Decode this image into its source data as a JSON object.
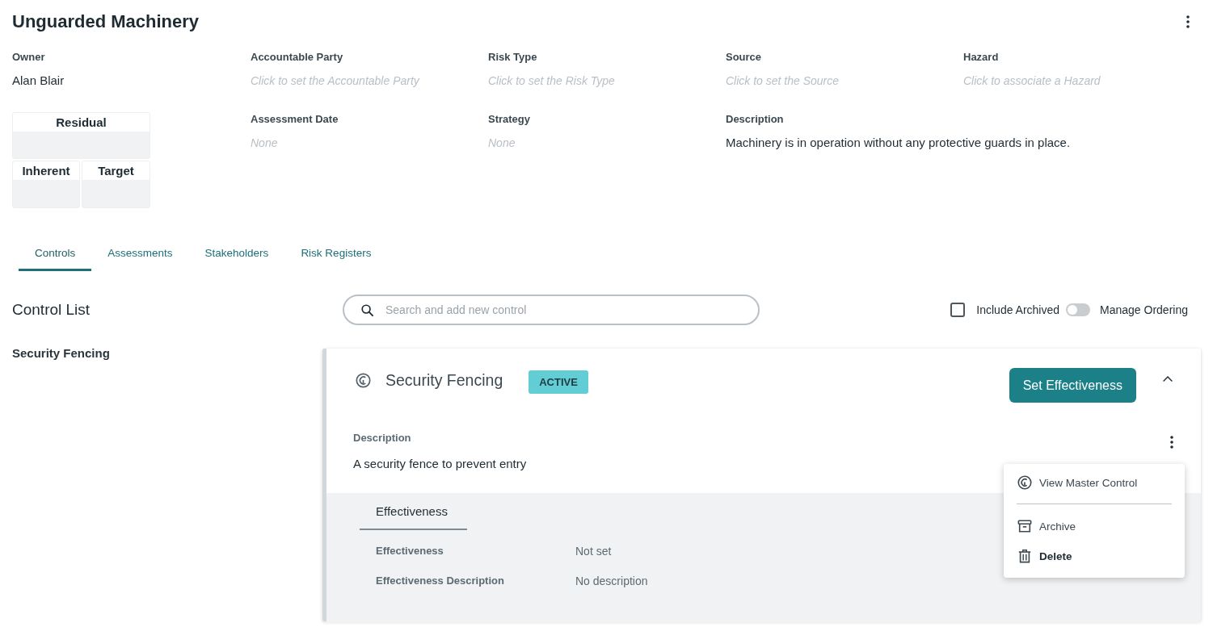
{
  "header": {
    "title": "Unguarded Machinery"
  },
  "fields": [
    {
      "label": "Owner",
      "value": "Alan Blair"
    },
    {
      "label": "Accountable Party",
      "placeholder": "Click to set the Accountable Party"
    },
    {
      "label": "Risk Type",
      "placeholder": "Click to set the Risk Type"
    },
    {
      "label": "Source",
      "placeholder": "Click to set the Source"
    },
    {
      "label": "Hazard",
      "placeholder": "Click to associate a Hazard"
    },
    {
      "label": "Assessment Date",
      "placeholder": "None"
    },
    {
      "label": "Strategy",
      "placeholder": "None"
    },
    {
      "label": "Description",
      "value": "Machinery is in operation without any protective guards in place."
    }
  ],
  "risk_ratings": [
    {
      "label": "Residual"
    },
    {
      "label": "Inherent"
    },
    {
      "label": "Target"
    }
  ],
  "tabs": [
    {
      "label": "Controls",
      "selected": true
    },
    {
      "label": "Assessments",
      "selected": false
    },
    {
      "label": "Stakeholders",
      "selected": false
    },
    {
      "label": "Risk Registers",
      "selected": false
    }
  ],
  "control_list": {
    "title": "Control List",
    "search": {
      "placeholder": "Search and add new control"
    },
    "include_archived": {
      "label": "Include Archived",
      "checked": false
    },
    "manage_ordering": {
      "label": "Manage Ordering",
      "on": false
    },
    "items": [
      {
        "label": "Security Fencing"
      }
    ]
  },
  "control_card": {
    "title": "Security Fencing",
    "status": "ACTIVE",
    "action": "Set Effectiveness",
    "expanded": true,
    "description_label": "Description",
    "description": "A security fence to prevent entry",
    "effectiveness": {
      "tabs": [
        {
          "label": "Effectiveness",
          "selected": true
        }
      ],
      "rows": [
        {
          "label": "Effectiveness",
          "value": "Not set"
        },
        {
          "label": "Effectiveness Description",
          "value": "No description"
        }
      ]
    }
  },
  "context_menu": {
    "groups": [
      [
        {
          "label": "View Master Control",
          "kind": "view"
        }
      ],
      [
        {
          "label": "Archive",
          "kind": "archive"
        },
        {
          "label": "Delete",
          "kind": "delete"
        }
      ]
    ]
  }
}
